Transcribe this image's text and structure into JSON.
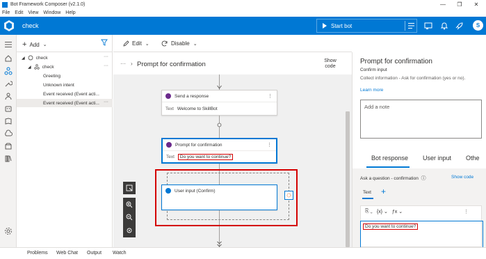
{
  "window": {
    "title": "Bot Framework Composer (v2.1.0)",
    "controls": [
      "—",
      "❐",
      "✕"
    ]
  },
  "menubar": {
    "items": [
      "File",
      "Edit",
      "View",
      "Window",
      "Help"
    ]
  },
  "header": {
    "bot_name": "check",
    "start_bot_label": "Start bot",
    "avatar_initial": "S",
    "accent": "#0078d4"
  },
  "nav": {
    "add_label": "Add",
    "items": [
      {
        "label": "check",
        "more": "···"
      },
      {
        "label": "check",
        "more": "···"
      },
      {
        "label": "Greeting"
      },
      {
        "label": "Unknown intent"
      },
      {
        "label": "Event received (Event acti..."
      },
      {
        "label": "Event received (Event acti...",
        "more": "···"
      }
    ]
  },
  "toolbar": {
    "edit_label": "Edit",
    "disable_label": "Disable"
  },
  "breadcrumb": {
    "dots": "···",
    "current": "Prompt for confirmation",
    "show_code": "Show code"
  },
  "canvas": {
    "send_card": {
      "title": "Send a response",
      "body_label": "Text",
      "body_value": "Welcome to SkillBot"
    },
    "prompt_card": {
      "title": "Prompt for confirmation",
      "body_label": "Text",
      "body_value": "Do you want to continue?"
    },
    "input_card": {
      "title": "User input (Confirm)"
    },
    "highlight_color": "#d40000"
  },
  "properties": {
    "title": "Prompt for confirmation",
    "subtitle": "Confirm input",
    "description": "Collect information - Ask for confirmation (yes or no).",
    "learn_more": "Learn more",
    "note_placeholder": "Add a note",
    "tabs": [
      "Bot response",
      "User input",
      "Othe"
    ],
    "ask_label": "Ask a question - confirmation",
    "show_code": "Show code",
    "text_tab": "Text",
    "editor_value": "Do you want to continue?"
  },
  "bottombar": {
    "items": [
      "Problems",
      "Web Chat",
      "Output",
      "Watch"
    ]
  }
}
